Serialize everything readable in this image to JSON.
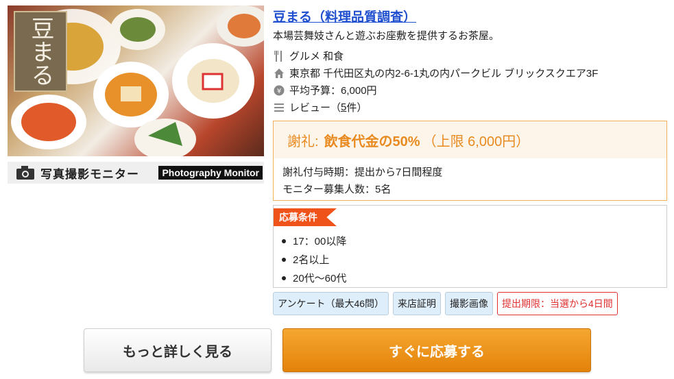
{
  "listing": {
    "title": "豆まる（料理品質調査）",
    "description": "本場芸舞妓さんと遊ぶお座敷を提供するお茶屋。",
    "photo_caption": "写真撮影モニター",
    "photo_caption_en": "Photography Monitor",
    "logo_text": "豆まる"
  },
  "info": {
    "category": "グルメ 和食",
    "address": "東京都 千代田区丸の内2-6-1丸の内パークビル ブリックスクエア3F",
    "budget": "平均予算：6,000円",
    "reviews_prefix": "レビュー（",
    "reviews_count": "5",
    "reviews_suffix": "件）"
  },
  "reward": {
    "label": "謝礼:",
    "value": "飲食代金の50%",
    "cap": "（上限 6,000円）",
    "timing": "謝礼付与時期：提出から7日間程度",
    "recruits": "モニター募集人数：5名"
  },
  "conditions": {
    "tag": "応募条件",
    "items": [
      "17：00以降",
      "2名以上",
      "20代〜60代"
    ]
  },
  "tags": [
    "アンケート（最大46問）",
    "来店証明",
    "撮影画像",
    "提出期限：当選から4日間"
  ],
  "buttons": {
    "more": "もっと詳しく見る",
    "apply": "すぐに応募する"
  },
  "icons": {
    "category": "fork-knife-icon",
    "address": "house-icon",
    "budget": "yen-coin-icon",
    "reviews": "list-icon",
    "camera": "camera-icon"
  },
  "colors": {
    "title_link": "#1f4fcf",
    "reward_accent": "#e88a1f",
    "condition_tag": "#f0531a",
    "apply_button": "#e4820a",
    "deadline_tag": "#e03030"
  }
}
